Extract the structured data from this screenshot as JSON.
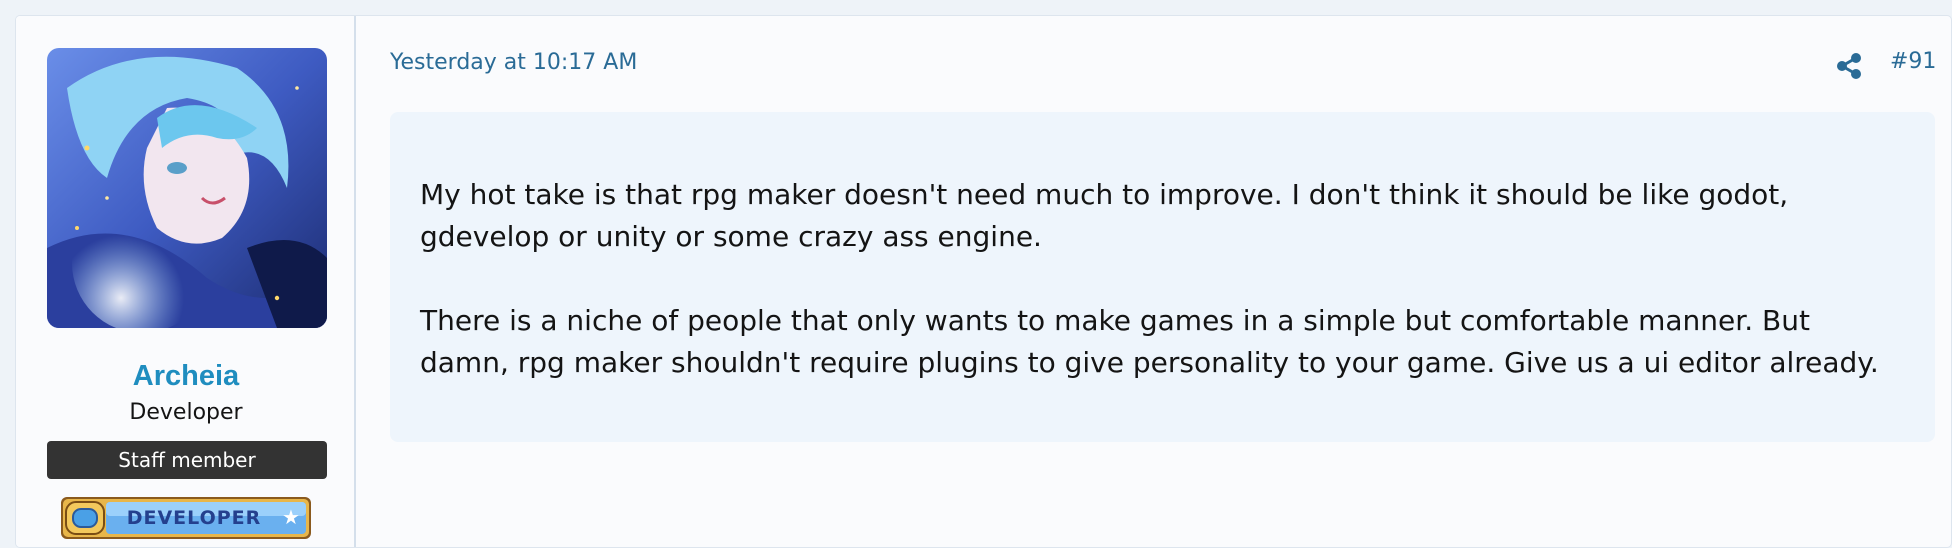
{
  "user": {
    "username": "Archeia",
    "title": "Developer",
    "staff_badge": "Staff member",
    "banner_text": "DEVELOPER",
    "banner_star": "★"
  },
  "post": {
    "timestamp": "Yesterday at 10:17 AM",
    "number": "#91",
    "paragraphs": [
      "My hot take is that rpg maker doesn't need much to improve. I don't think it should be like godot, gdevelop or unity or some crazy ass engine.",
      "There is a niche of people that only wants to make games in a simple but comfortable manner. But damn, rpg maker shouldn't require plugins to give personality to your game. Give us a ui editor already."
    ]
  },
  "icons": {
    "share": "share-icon"
  },
  "colors": {
    "link": "#2a6b96",
    "username": "#1f8dbf",
    "staff_badge_bg": "#333333",
    "content_bg": "#eef5fc"
  }
}
